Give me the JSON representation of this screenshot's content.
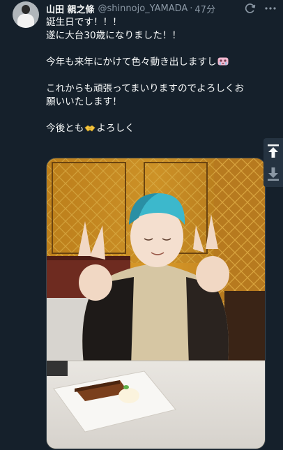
{
  "tweet": {
    "display_name": "山田 親之條",
    "handle": "@shinnojo_YAMADA",
    "separator": "·",
    "time": "47分",
    "lines": [
      "誕生日です！！！",
      "遂に大台30歳になりました！！",
      "",
      "今年も来年にかけて色々動き出しますし",
      "",
      "これからも頑張ってまいりますのでよろしくお",
      "願いいたします！",
      "",
      "今後とも",
      "よろしく"
    ]
  },
  "icons": {
    "avatar": "avatar",
    "sync": "sync-icon",
    "more": "more-dots-icon",
    "emoji_1": "crying-face-emoji",
    "emoji_2": "handshake-emoji",
    "scroll_up": "scroll-to-top-icon",
    "scroll_down": "scroll-to-bottom-icon"
  },
  "colors": {
    "background": "#15202b",
    "text": "#f7f9f9",
    "muted": "#8b98a5"
  }
}
